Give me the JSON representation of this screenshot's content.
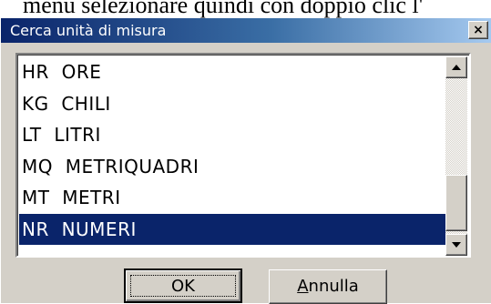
{
  "document": {
    "background_text": "menù selezionare quindi con doppio clic l'"
  },
  "window": {
    "title": "Cerca unità di misura",
    "close_glyph": "×"
  },
  "list": {
    "items": [
      {
        "code": "HR",
        "label": "ORE",
        "selected": false
      },
      {
        "code": "KG",
        "label": "CHILI",
        "selected": false
      },
      {
        "code": "LT",
        "label": "LITRI",
        "selected": false
      },
      {
        "code": "MQ",
        "label": "METRIQUADRI",
        "selected": false
      },
      {
        "code": "MT",
        "label": "METRI",
        "selected": false
      },
      {
        "code": "NR",
        "label": "NUMERI",
        "selected": true
      }
    ],
    "rows_text": [
      "HR  ORE",
      "KG  CHILI",
      "LT  LITRI",
      "MQ  METRIQUADRI",
      "MT  METRI",
      "NR  NUMERI"
    ],
    "scroll_position_fraction": 0.75
  },
  "buttons": {
    "ok_label": "OK",
    "cancel_label_prefix": "",
    "cancel_label_mnemonic": "A",
    "cancel_label_rest": "nnulla"
  },
  "icons": {
    "scroll_up": "scroll-up-arrow-icon",
    "scroll_down": "scroll-down-arrow-icon"
  },
  "colors": {
    "title_start": "#0a246a",
    "title_end": "#a6caf0",
    "selection": "#0a246a",
    "face": "#d4d0c8"
  }
}
